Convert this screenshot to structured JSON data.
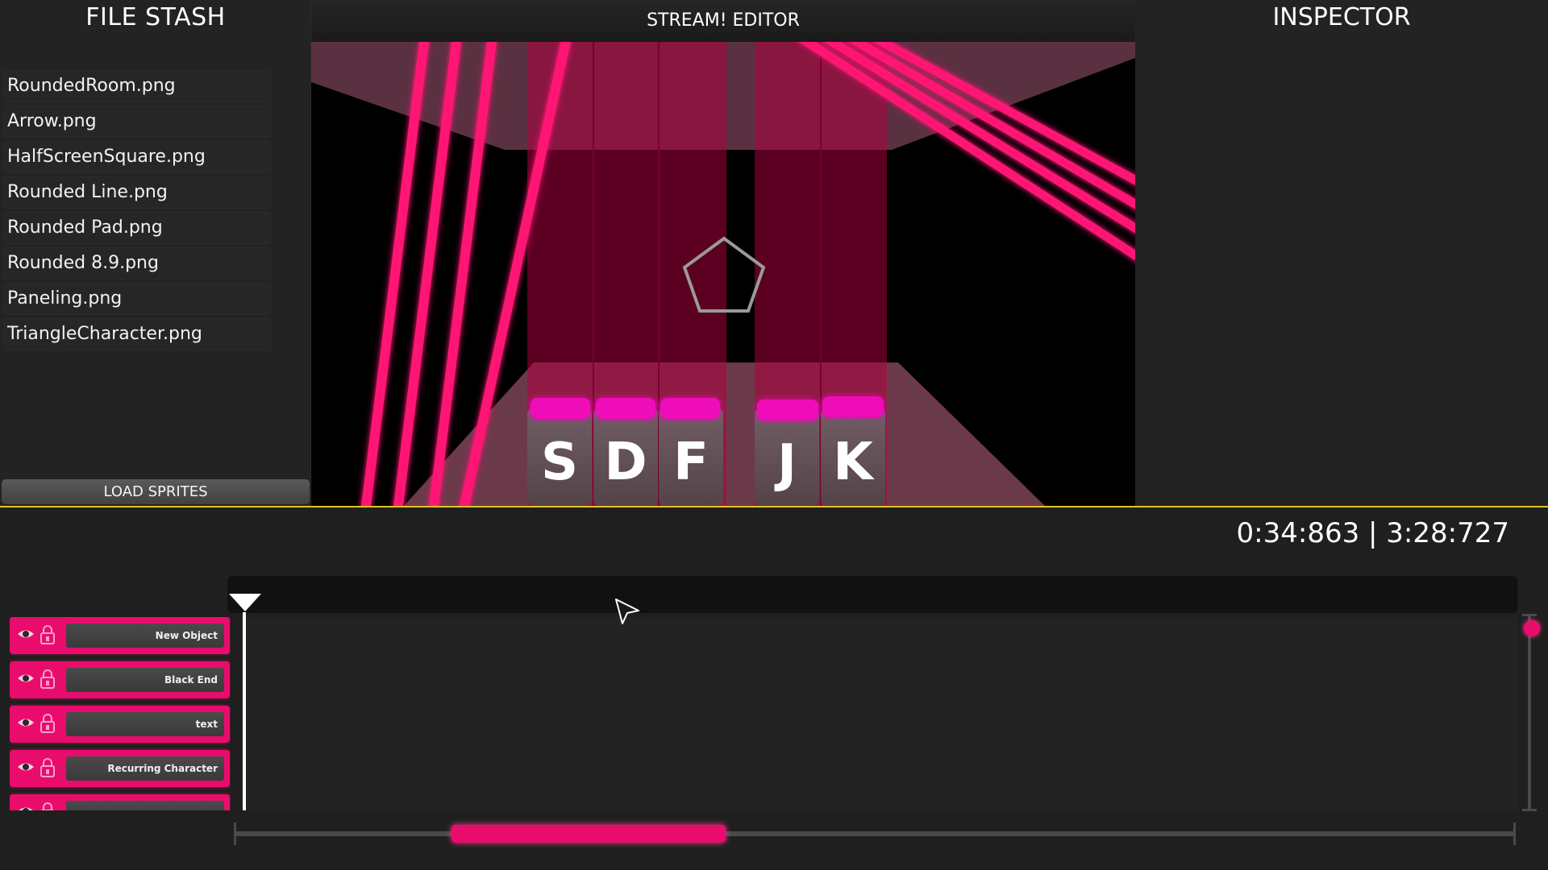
{
  "file_stash": {
    "title": "FILE STASH",
    "files": [
      "RoundedRoom.png",
      "Arrow.png",
      "HalfScreenSquare.png",
      "Rounded Line.png",
      "Rounded Pad.png",
      "Rounded 8.9.png",
      "Paneling.png",
      "TriangleCharacter.png"
    ],
    "load_button": "LOAD SPRITES"
  },
  "viewport": {
    "title": "STREAM! EDITOR",
    "keys": [
      "S",
      "D",
      "F",
      "J",
      "K"
    ]
  },
  "inspector": {
    "title": "INSPECTOR"
  },
  "timeline": {
    "time_readout": "0:34:863 | 3:28:727",
    "layers": [
      {
        "name": "New Object"
      },
      {
        "name": "Black End"
      },
      {
        "name": "text"
      },
      {
        "name": "Recurring Character"
      },
      {
        "name": ""
      }
    ]
  },
  "icons": {
    "visibility": "eye-icon",
    "lock": "lock-icon",
    "playhead": "playhead-triangle-icon",
    "cursor": "mouse-cursor-icon"
  },
  "colors": {
    "accent": "#ea0c6d",
    "panel_background": "#232323",
    "timeline_border": "#e7c21d"
  }
}
